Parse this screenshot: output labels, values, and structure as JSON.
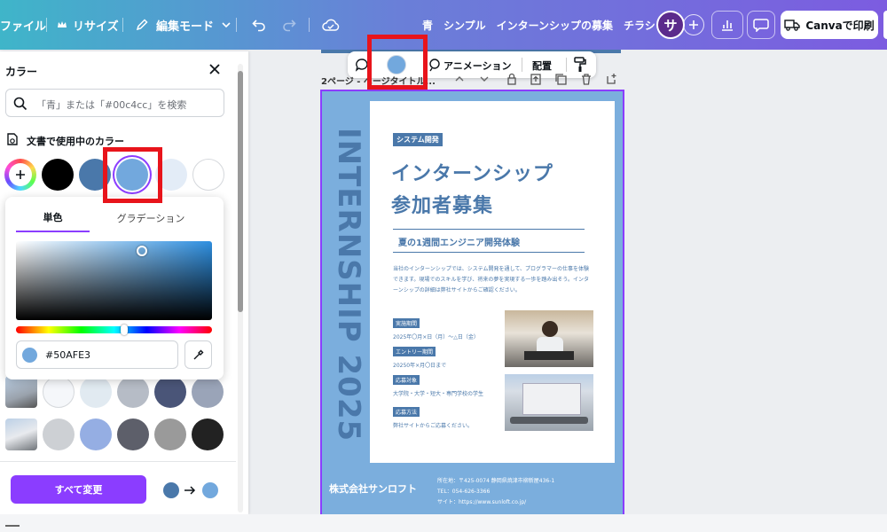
{
  "topbar": {
    "file": "ファイル",
    "resize": "リサイズ",
    "edit_mode": "編集モード",
    "doc_title": "青　シンプル　インターンシップの募集　チラシ",
    "avatar_letter": "サ",
    "print": "Canvaで印刷"
  },
  "panel": {
    "title": "カラー",
    "search_placeholder": "「青」または「#00c4cc」を検索",
    "section_doc_colors": "文書で使用中のカラー",
    "change_all": "すべて変更",
    "doc_colors": [
      "#000000",
      "#4a78aa",
      "#72a8dd",
      "#e3ecf7",
      "#ffffff"
    ],
    "more_swatches": [
      "#f5f7fa",
      "#e1eaf1",
      "#b6bcc6",
      "#4a5578",
      "#9aa4b8",
      "#cdd0d4",
      "#95aee3",
      "#5d5f6a",
      "#9a9a9a",
      "#222222"
    ],
    "change_from": "#4a78aa",
    "change_to": "#72a8dd"
  },
  "picker": {
    "tab_solid": "単色",
    "tab_gradient": "グラデーション",
    "hex": "#50AFE3",
    "current_color": "#72a8dd"
  },
  "float_toolbar": {
    "animation": "アニメーション",
    "arrange": "配置"
  },
  "page_label": "2ページ - ページタイトル...",
  "poster": {
    "vertical_text": "INTERNSHIP 2025",
    "badge": "システム開発",
    "title1": "インターンシップ",
    "title2": "参加者募集",
    "subtitle": "夏の1週間エンジニア開発体験",
    "intro": "当社のインターンシップでは、システム開発を通して、プログラマーの仕事を体験できます。現場でのスキルを学び、将来の夢を実現する一歩を踏み出そう。インターンシップの詳細は弊社サイトからご確認ください。",
    "items": [
      {
        "label": "実施期間",
        "value": "2025年〇月×日（月）〜△日（金）"
      },
      {
        "label": "エントリー期間",
        "value": "20250年×月〇日まで"
      },
      {
        "label": "応募対象",
        "value": "大学院・大学・短大・専門学校の学生"
      },
      {
        "label": "応募方法",
        "value": "弊社サイトからご応募ください。"
      }
    ],
    "company": "株式会社サンロフト",
    "address": "所在地：〒425-0074 静岡県焼津市柳新屋436-1",
    "tel": "TEL：054-626-3366",
    "site": "サイト：https://www.sunloft.co.jp/"
  },
  "colors": {
    "accent": "#8b3dff",
    "poster_blue": "#4a78aa",
    "poster_light": "#7baedd",
    "highlight": "#e8141b"
  }
}
